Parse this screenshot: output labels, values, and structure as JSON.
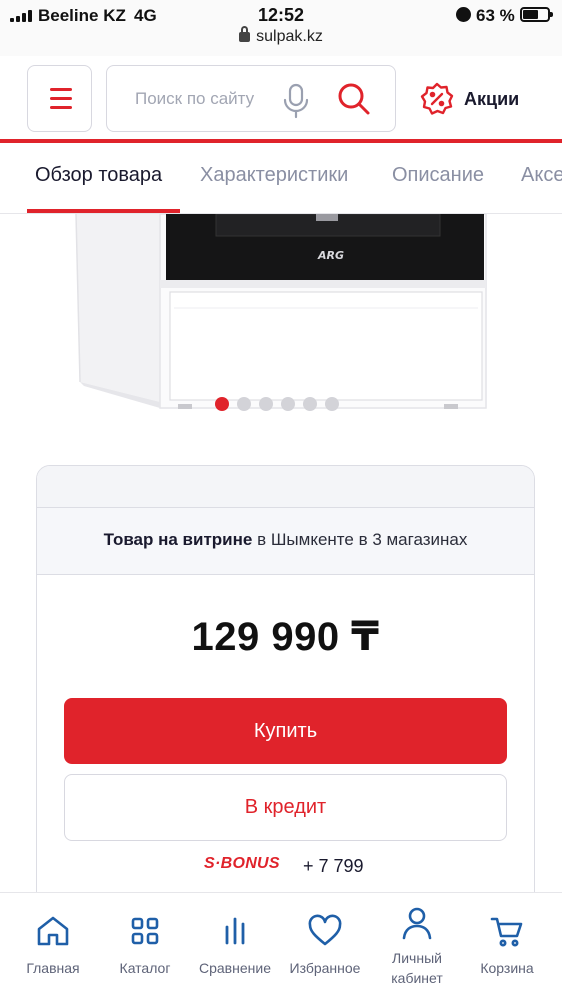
{
  "status_bar": {
    "carrier": "Beeline KZ",
    "network": "4G",
    "time": "12:52",
    "url": "sulpak.kz",
    "battery_percent": "63 %",
    "battery_level": 0.63
  },
  "header": {
    "search_placeholder": "Поиск по сайту",
    "promo_label": "Акции"
  },
  "tabs": [
    {
      "label": "Обзор товара",
      "active": true
    },
    {
      "label": "Характеристики",
      "active": false
    },
    {
      "label": "Описание",
      "active": false
    },
    {
      "label": "Аксессуары",
      "active": false
    }
  ],
  "gallery": {
    "brand_on_product": "ARG",
    "slide_count": 6,
    "active_slide": 1
  },
  "product_card": {
    "availability_bold": "Товар на витрине",
    "availability_rest": "в Шымкенте в 3 магазинах",
    "price": "129 990 ₸",
    "buy_label": "Купить",
    "credit_label": "В кредит",
    "bonus_logo": "S·BONUS",
    "bonus_points": "+ 7 799"
  },
  "bottom_nav": [
    {
      "label": "Главная",
      "icon": "home-icon"
    },
    {
      "label": "Каталог",
      "icon": "catalog-icon"
    },
    {
      "label": "Сравнение",
      "icon": "compare-icon"
    },
    {
      "label": "Избранное",
      "icon": "heart-icon"
    },
    {
      "label_line1": "Личный",
      "label_line2": "кабинет",
      "icon": "user-icon"
    },
    {
      "label": "Корзина",
      "icon": "cart-icon"
    }
  ],
  "colors": {
    "brand_red": "#e0232b",
    "text_dark": "#1a1a2e",
    "text_muted": "#8a8fa3"
  }
}
